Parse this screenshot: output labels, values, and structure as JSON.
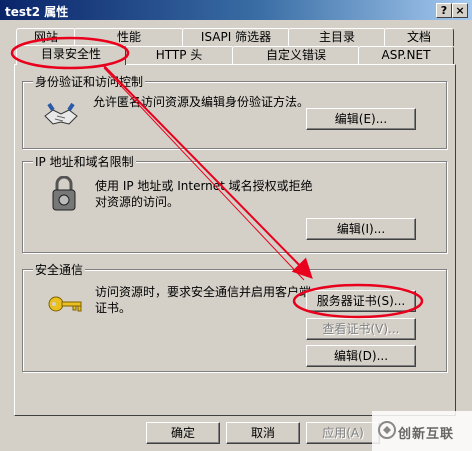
{
  "window": {
    "title": "test2 属性",
    "help_label": "?",
    "close_label": "×"
  },
  "tabs_row1": [
    "网站",
    "性能",
    "ISAPI 筛选器",
    "主目录",
    "文档"
  ],
  "tabs_row2": [
    "目录安全性",
    "HTTP 头",
    "自定义错误",
    "ASP.NET"
  ],
  "groups": {
    "auth": {
      "title": "身份验证和访问控制",
      "desc": "允许匿名访问资源及编辑身份验证方法。",
      "button": "编辑(E)..."
    },
    "ip": {
      "title": "IP 地址和域名限制",
      "desc": "使用 IP 地址或 Internet 域名授权或拒绝对资源的访问。",
      "button": "编辑(I)..."
    },
    "secure": {
      "title": "安全通信",
      "desc": "访问资源时，要求安全通信并启用客户端证书。",
      "button_cert": "服务器证书(S)...",
      "button_view": "查看证书(V)...",
      "button_edit": "编辑(D)..."
    }
  },
  "footer": {
    "ok": "确定",
    "cancel": "取消",
    "apply": "应用(A)"
  },
  "watermark": "创新互联",
  "colors": {
    "annotation": "#e8001c",
    "title_start": "#0a246a",
    "title_end": "#a6caf0"
  }
}
